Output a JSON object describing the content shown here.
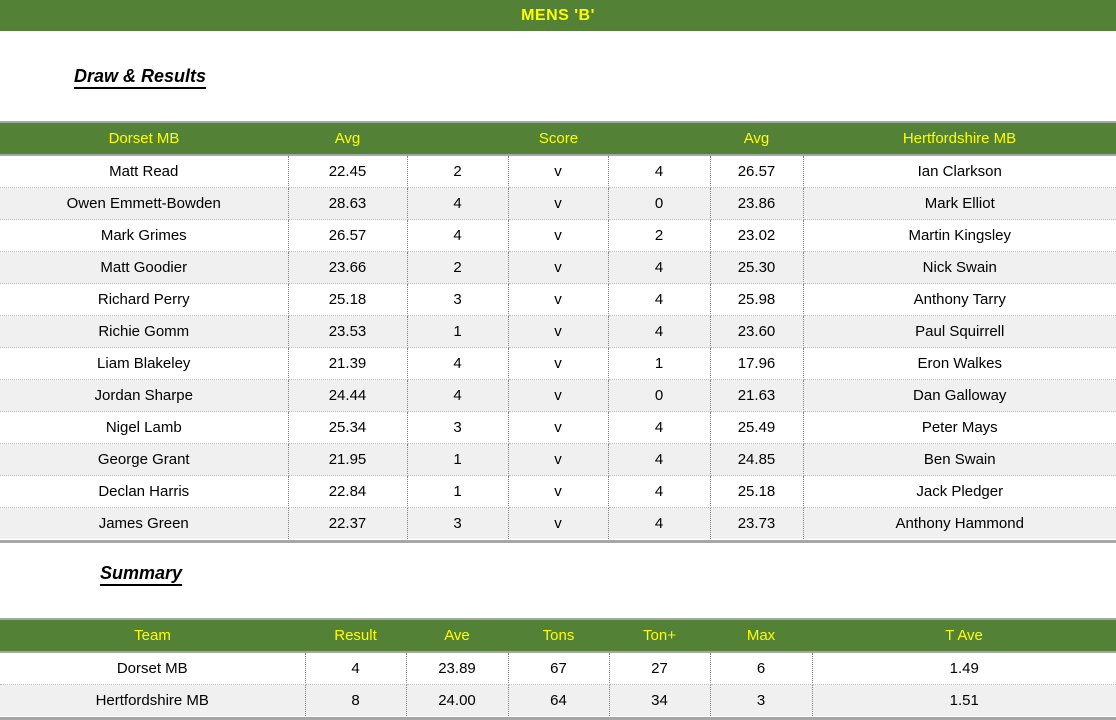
{
  "banner": {
    "title": "MENS 'B'"
  },
  "sections": {
    "draw_results_heading": "Draw & Results",
    "summary_heading": "Summary"
  },
  "colors": {
    "header_green": "#538135",
    "header_yellow": "#FFFF00",
    "alt_row_grey": "#F0F0F0",
    "border_grey": "#A6A6A6"
  },
  "fixtures_table": {
    "headers": {
      "home_team": "Dorset MB",
      "home_avg": "Avg",
      "score": "Score",
      "away_avg": "Avg",
      "away_team": "Hertfordshire MB"
    },
    "rows": [
      {
        "home_player": "Matt Read",
        "home_avg": "22.45",
        "home_score": "2",
        "v": "v",
        "away_score": "4",
        "away_avg": "26.57",
        "away_player": "Ian Clarkson"
      },
      {
        "home_player": "Owen Emmett-Bowden",
        "home_avg": "28.63",
        "home_score": "4",
        "v": "v",
        "away_score": "0",
        "away_avg": "23.86",
        "away_player": "Mark Elliot"
      },
      {
        "home_player": "Mark Grimes",
        "home_avg": "26.57",
        "home_score": "4",
        "v": "v",
        "away_score": "2",
        "away_avg": "23.02",
        "away_player": "Martin Kingsley"
      },
      {
        "home_player": "Matt Goodier",
        "home_avg": "23.66",
        "home_score": "2",
        "v": "v",
        "away_score": "4",
        "away_avg": "25.30",
        "away_player": "Nick Swain"
      },
      {
        "home_player": "Richard Perry",
        "home_avg": "25.18",
        "home_score": "3",
        "v": "v",
        "away_score": "4",
        "away_avg": "25.98",
        "away_player": "Anthony Tarry"
      },
      {
        "home_player": "Richie Gomm",
        "home_avg": "23.53",
        "home_score": "1",
        "v": "v",
        "away_score": "4",
        "away_avg": "23.60",
        "away_player": "Paul Squirrell"
      },
      {
        "home_player": "Liam Blakeley",
        "home_avg": "21.39",
        "home_score": "4",
        "v": "v",
        "away_score": "1",
        "away_avg": "17.96",
        "away_player": "Eron Walkes"
      },
      {
        "home_player": "Jordan Sharpe",
        "home_avg": "24.44",
        "home_score": "4",
        "v": "v",
        "away_score": "0",
        "away_avg": "21.63",
        "away_player": "Dan Galloway"
      },
      {
        "home_player": "Nigel Lamb",
        "home_avg": "25.34",
        "home_score": "3",
        "v": "v",
        "away_score": "4",
        "away_avg": "25.49",
        "away_player": "Peter Mays"
      },
      {
        "home_player": "George Grant",
        "home_avg": "21.95",
        "home_score": "1",
        "v": "v",
        "away_score": "4",
        "away_avg": "24.85",
        "away_player": "Ben Swain"
      },
      {
        "home_player": "Declan Harris",
        "home_avg": "22.84",
        "home_score": "1",
        "v": "v",
        "away_score": "4",
        "away_avg": "25.18",
        "away_player": "Jack Pledger"
      },
      {
        "home_player": "James Green",
        "home_avg": "22.37",
        "home_score": "3",
        "v": "v",
        "away_score": "4",
        "away_avg": "23.73",
        "away_player": "Anthony Hammond"
      }
    ]
  },
  "summary_table": {
    "headers": [
      "Team",
      "Result",
      "Ave",
      "Tons",
      "Ton+",
      "Max",
      "T Ave"
    ],
    "rows": [
      {
        "team": "Dorset MB",
        "result": "4",
        "ave": "23.89",
        "tons": "67",
        "ton_plus": "27",
        "max": "6",
        "t_ave": "1.49"
      },
      {
        "team": "Hertfordshire MB",
        "result": "8",
        "ave": "24.00",
        "tons": "64",
        "ton_plus": "34",
        "max": "3",
        "t_ave": "1.51"
      }
    ]
  }
}
